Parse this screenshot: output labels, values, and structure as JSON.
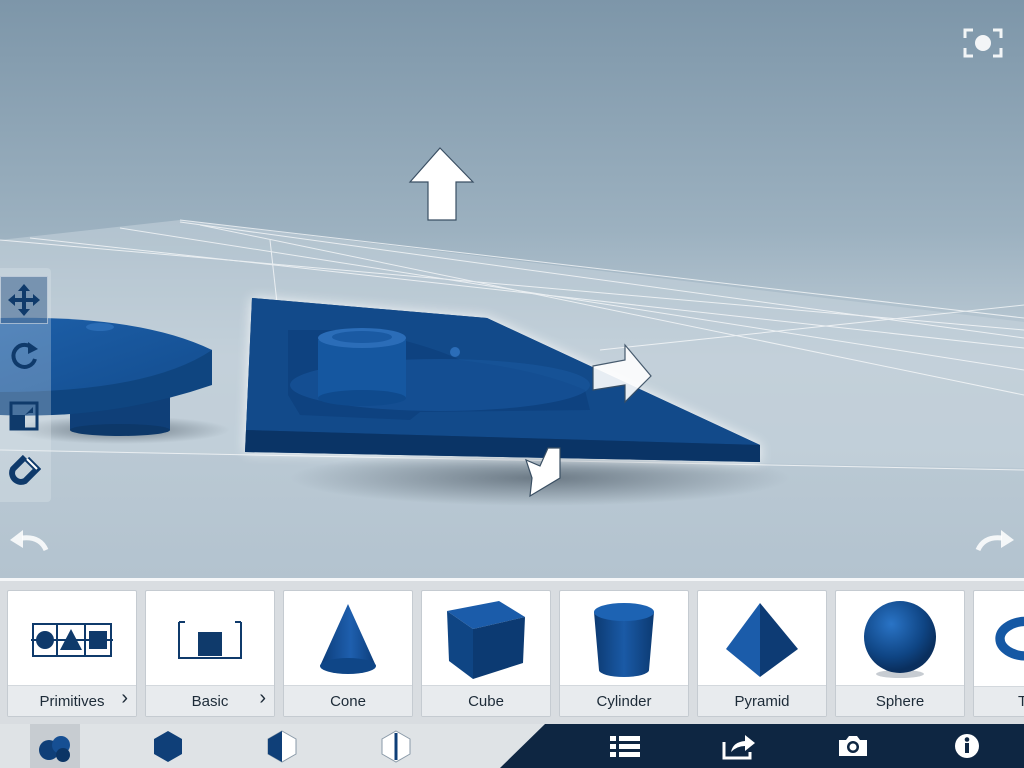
{
  "viewport": {
    "background_color": "#8fa7b8",
    "model_color": "#124a8a",
    "fullscreen_icon": "fullscreen-icon"
  },
  "tools": [
    {
      "name": "move-tool",
      "icon": "move-arrows-icon",
      "active": true
    },
    {
      "name": "rotate-tool",
      "icon": "rotate-icon",
      "active": false
    },
    {
      "name": "scale-tool",
      "icon": "scale-icon",
      "active": false
    },
    {
      "name": "snap-tool",
      "icon": "magnet-icon",
      "active": false
    }
  ],
  "library": {
    "items": [
      {
        "label": "Primitives",
        "icon": "primitives-icon",
        "has_submenu": true
      },
      {
        "label": "Basic",
        "icon": "basic-bin-icon",
        "has_submenu": true
      },
      {
        "label": "Cone",
        "icon": "cone-icon",
        "has_submenu": false
      },
      {
        "label": "Cube",
        "icon": "cube-icon",
        "has_submenu": false
      },
      {
        "label": "Cylinder",
        "icon": "cylinder-icon",
        "has_submenu": false
      },
      {
        "label": "Pyramid",
        "icon": "pyramid-icon",
        "has_submenu": false
      },
      {
        "label": "Sphere",
        "icon": "sphere-icon",
        "has_submenu": false
      },
      {
        "label": "T",
        "icon": "torus-icon",
        "has_submenu": false
      }
    ]
  },
  "bottombar": {
    "left_icons": [
      "shapes-icon",
      "solid-hexagon-icon",
      "half-hexagon-icon",
      "outline-hexagon-icon"
    ],
    "right_icons": [
      "list-icon",
      "share-icon",
      "camera-icon",
      "info-icon"
    ],
    "dark_color": "#0e2642"
  },
  "undo_icon": "undo-icon",
  "redo_icon": "redo-icon"
}
